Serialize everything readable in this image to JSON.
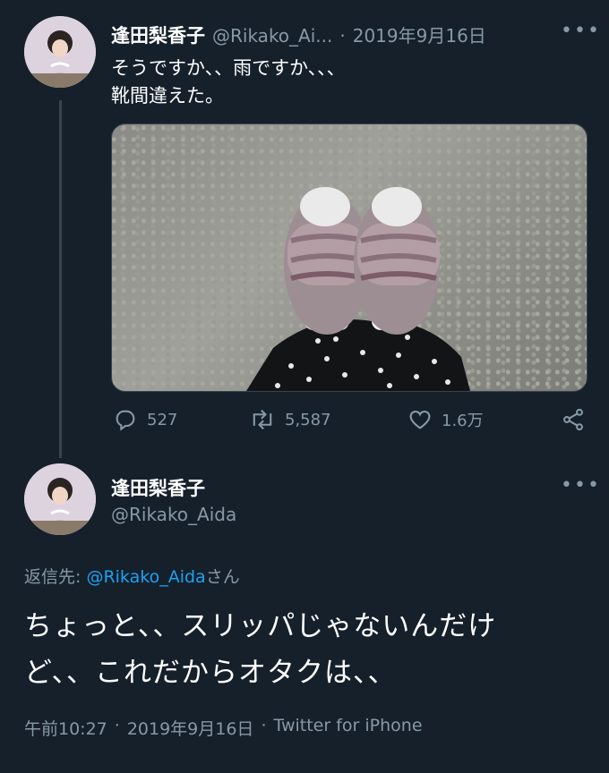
{
  "tweet1": {
    "author_name": "逢田梨香子",
    "author_handle": "@Rikako_Ai...",
    "separator": "·",
    "date": "2019年9月16日",
    "more_label": "•••",
    "text_line1": "そうですか、、雨ですか、、、",
    "text_line2": "靴間違えた。",
    "actions": {
      "reply_count": "527",
      "retweet_count": "5,587",
      "like_count": "1.6万"
    }
  },
  "tweet2": {
    "author_name": "逢田梨香子",
    "author_handle": "@Rikako_Aida",
    "more_label": "•••",
    "reply_prefix": "返信先: ",
    "reply_target": "@Rikako_Aida",
    "reply_suffix": "さん",
    "text_line1": "ちょっと、、スリッパじゃないんだけ",
    "text_line2": "ど、、これだからオタクは、、",
    "meta_time": "午前10:27",
    "meta_sep1": "·",
    "meta_date": "2019年9月16日",
    "meta_sep2": "·",
    "meta_source": "Twitter for iPhone"
  },
  "colors": {
    "background": "#15202b",
    "muted": "#8899a6",
    "link": "#1da1f2",
    "divider": "#38444d"
  }
}
